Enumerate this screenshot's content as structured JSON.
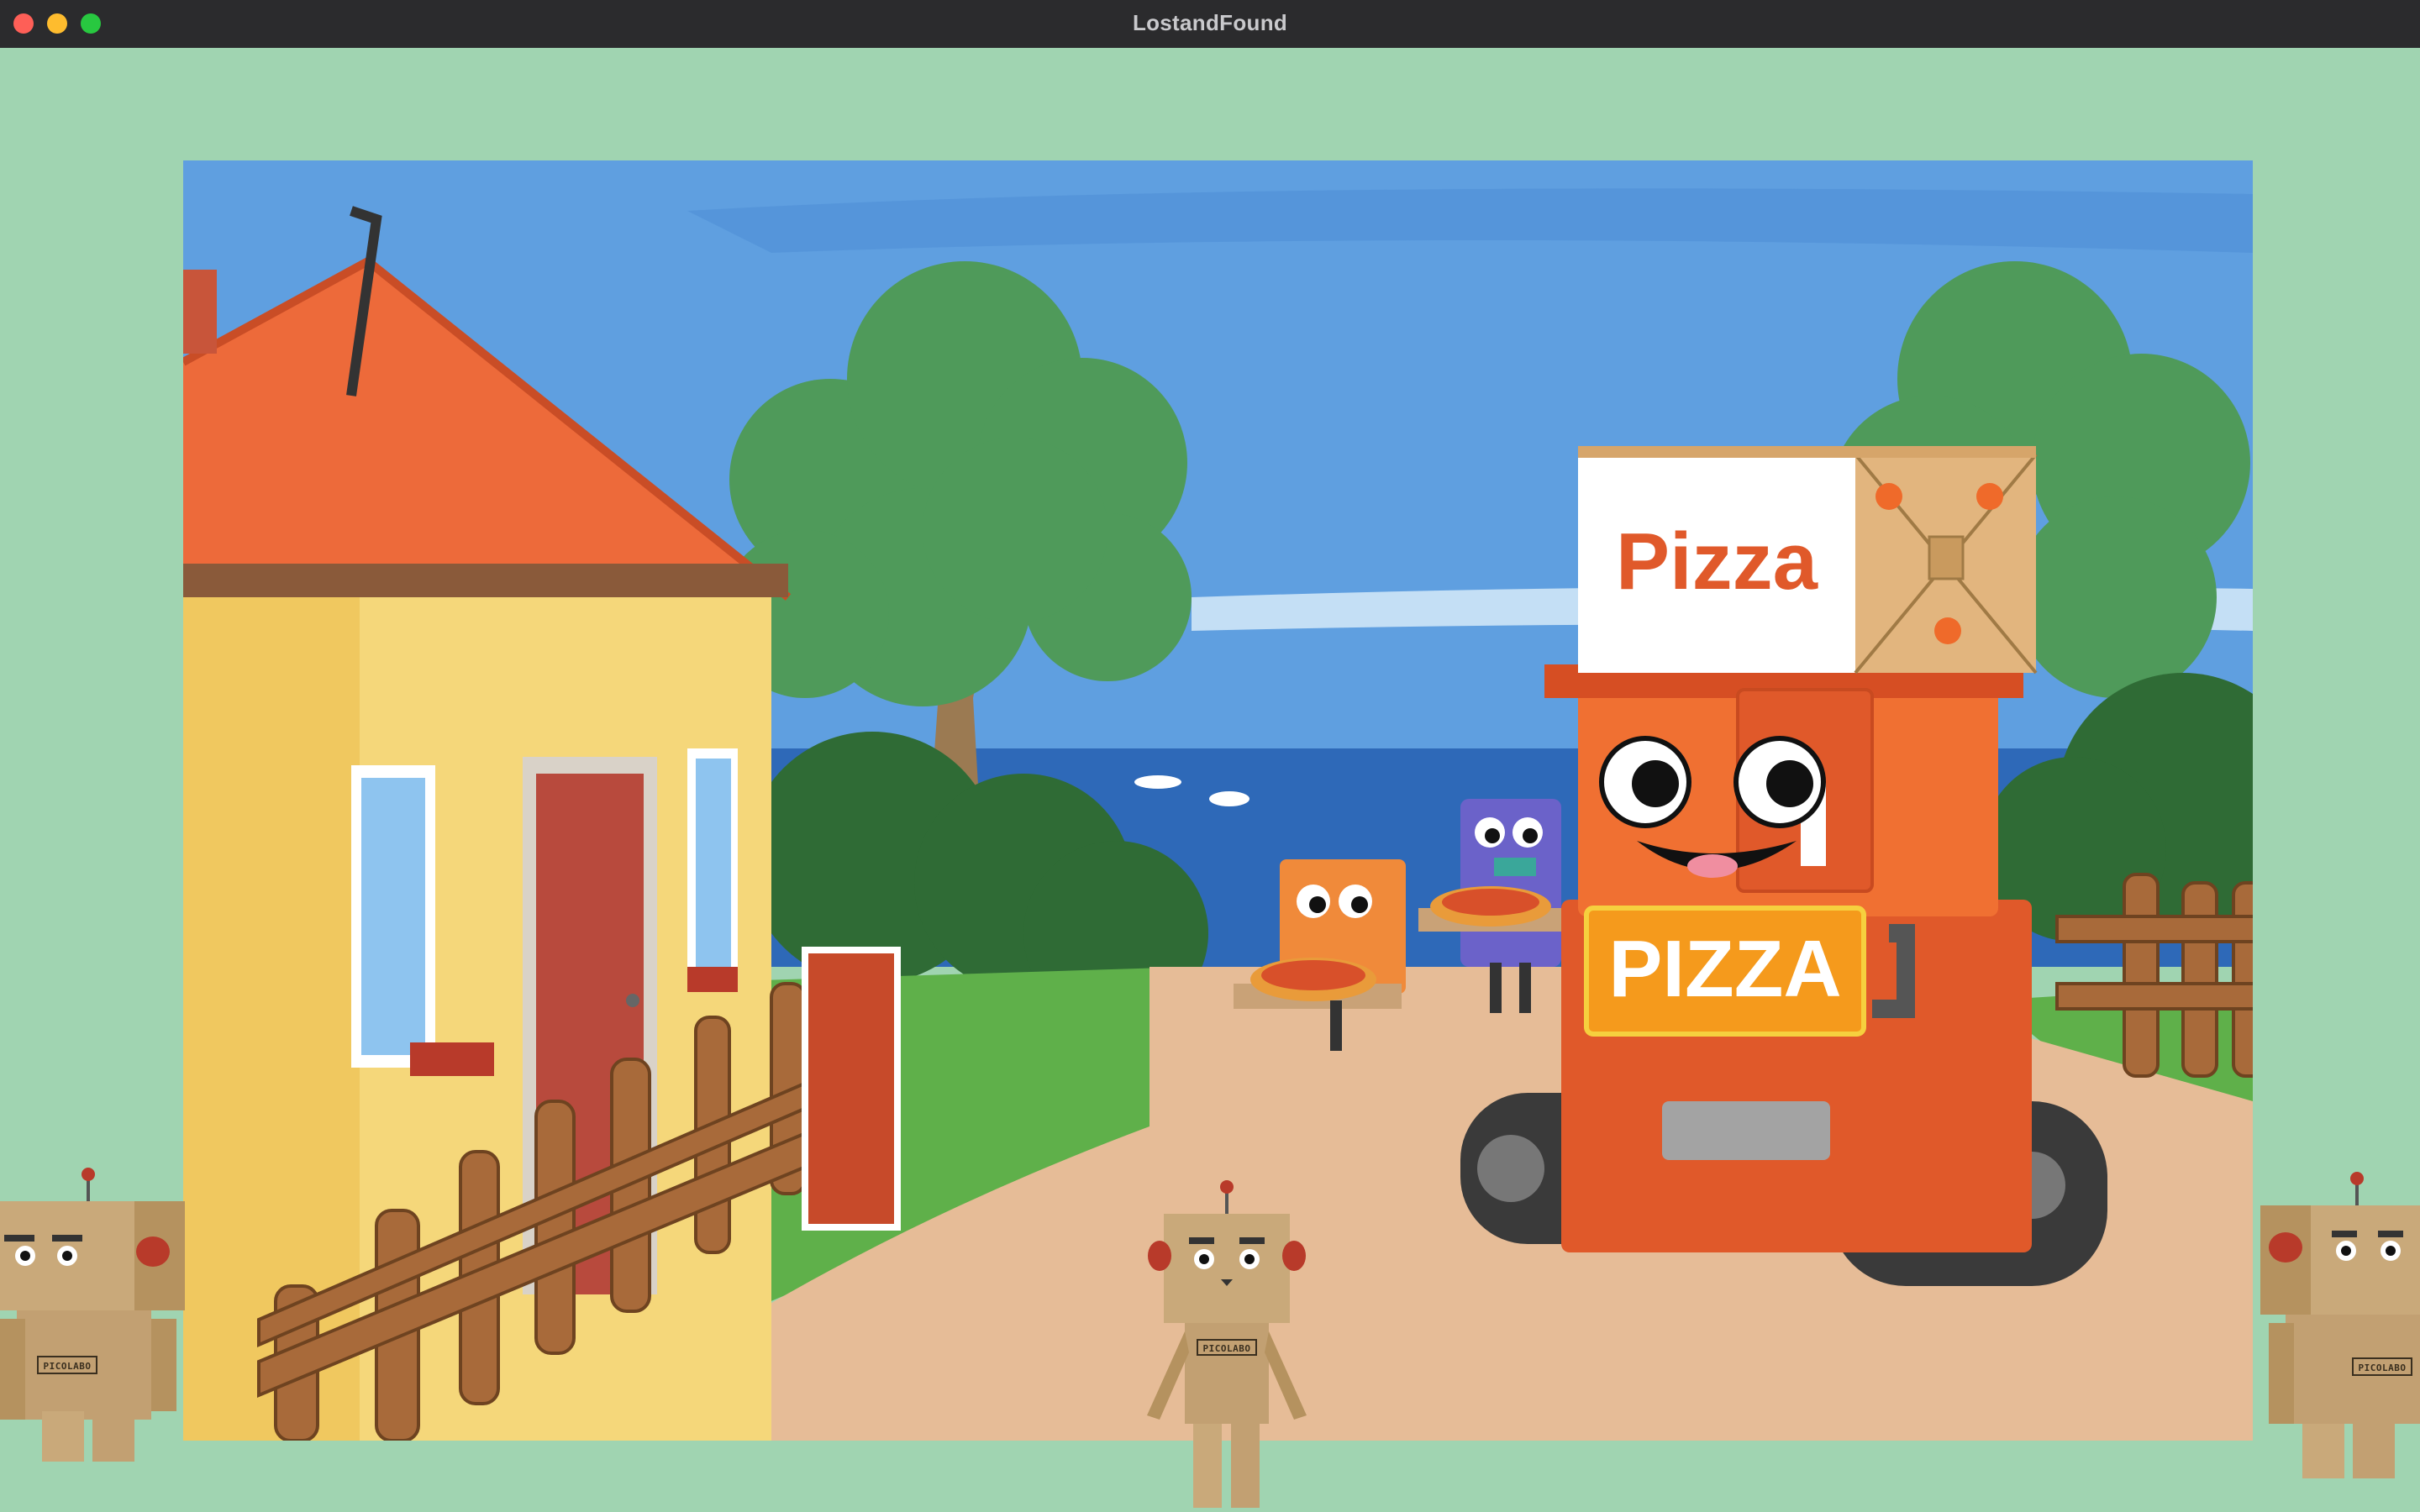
{
  "window": {
    "title": "LostandFound",
    "controls": [
      "close",
      "minimize",
      "zoom"
    ]
  },
  "scene": {
    "pizza_box_text": "Pizza",
    "robot_sign_text": "PIZZA"
  },
  "robots": {
    "box_label": "PICOLABO"
  },
  "colors": {
    "background": "#a0d4b1",
    "titlebar": "#2b2b2d",
    "pizza_orange": "#ef6a2a",
    "cardboard": "#c9a97a"
  }
}
